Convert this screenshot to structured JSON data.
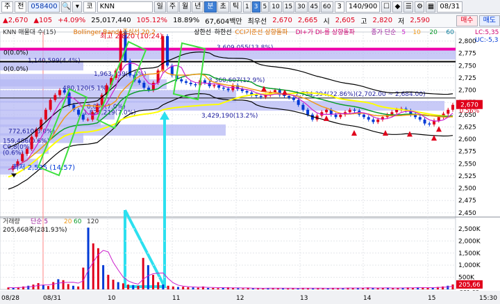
{
  "toolbar": {
    "mode": "주",
    "scope": "전",
    "code": "058400",
    "market": "코",
    "name": "KNN",
    "periods": [
      "일",
      "주",
      "월",
      "년",
      "분",
      "초",
      "틱"
    ],
    "intervals": [
      "1",
      "3",
      "5",
      "10",
      "15",
      "30",
      "45",
      "60"
    ],
    "interval_select": "3",
    "count": "140/900",
    "date": "08/31",
    "buy_label": "매수",
    "sell_label": "매도"
  },
  "info": {
    "price": "2,670",
    "change": "105",
    "change_pct": "+4.09%",
    "volume": "25,017,440",
    "vol_ratio": "105.12%",
    "turnover_pct": "18.89%",
    "amount": "67,604백만",
    "best_ask_label": "최우선",
    "best_ask": "2,670",
    "best_bid": "2,665",
    "open_label": "시",
    "open": "2,605",
    "high_label": "고",
    "high": "2,820",
    "low_label": "저",
    "low": "2,590"
  },
  "legend": {
    "title": "KNN 매물대 수(15)",
    "bb": "Bollinger Bands중심선 20,2",
    "upper": "상한선",
    "lower": "하한선",
    "cci": "CCI기준선 상향돌파",
    "dmi": "DI+가 DI-를 상향돌파",
    "ma_label": "종가 단순",
    "ma_periods": [
      "5",
      "10",
      "20",
      "60"
    ],
    "lc_right": "LC:5,35",
    "lc_right2": "UC:-5,3"
  },
  "price_axis": [
    "2,800",
    "2,775",
    "2,750",
    "2,725",
    "2,700",
    "2,675",
    "2,650",
    "2,625",
    "2,600",
    "2,575",
    "2,550",
    "2,525",
    "2,500",
    "2,475",
    "2,450"
  ],
  "price_axis_values": [
    2800,
    2775,
    2750,
    2725,
    2700,
    2675,
    2650,
    2625,
    2600,
    2575,
    2550,
    2525,
    2500,
    2475,
    2450
  ],
  "price_tags": {
    "current": "2,670",
    "pct": "0.56%"
  },
  "annotations": {
    "high": "최고 2,820 (10:24)",
    "low": "최저 2,535 (14:57)",
    "zero1": "0(0.0%)",
    "zero2": "0(0.0%)",
    "range_label": "2,734,394(22.86%)(2,702.00 ~ 2,684.00)"
  },
  "volume_profile": [
    {
      "label": "3,609,055(13.8%)"
    },
    {
      "label": "1,140,599(4.4%)"
    },
    {
      "label": "1,963,359(7.5%)"
    },
    {
      "label": "3,360,607(12.9%)"
    },
    {
      "label": "480,120(5.1%)"
    },
    {
      "label": "0,098(7.0%)"
    },
    {
      "label": "1,825,219(7.0%)"
    },
    {
      "label": "3,429,190(13.2%)"
    },
    {
      "label": "772,610(3.0%)"
    },
    {
      "label": "159,486(0.6%)"
    },
    {
      "label": "C0,8(0%)"
    },
    {
      "label": "(0.6%)"
    }
  ],
  "volume_panel": {
    "title": "거래량",
    "ma_label": "단순",
    "periods": [
      "5",
      "20",
      "60",
      "120"
    ],
    "current": "205,668주(281.93%)",
    "axis": [
      "2,500K",
      "2,000K",
      "1,500K",
      "1,000K",
      "500K"
    ],
    "axis_values": [
      2500,
      2000,
      1500,
      1000,
      500
    ],
    "tag": "205,66",
    "tag2": "281.93"
  },
  "time_axis": [
    "08/28",
    "08/31",
    "10",
    "11",
    "12",
    "13",
    "14",
    "15",
    "15:30"
  ],
  "colors": {
    "up": "#e0001b",
    "down": "#0039d6",
    "profile": "#b6b8f4",
    "magenta": "#ee00aa",
    "green_box": "#3ee03e",
    "cyan": "#2ce0ef",
    "bb_upper": "#000000",
    "ma60": "#ffff00"
  }
}
